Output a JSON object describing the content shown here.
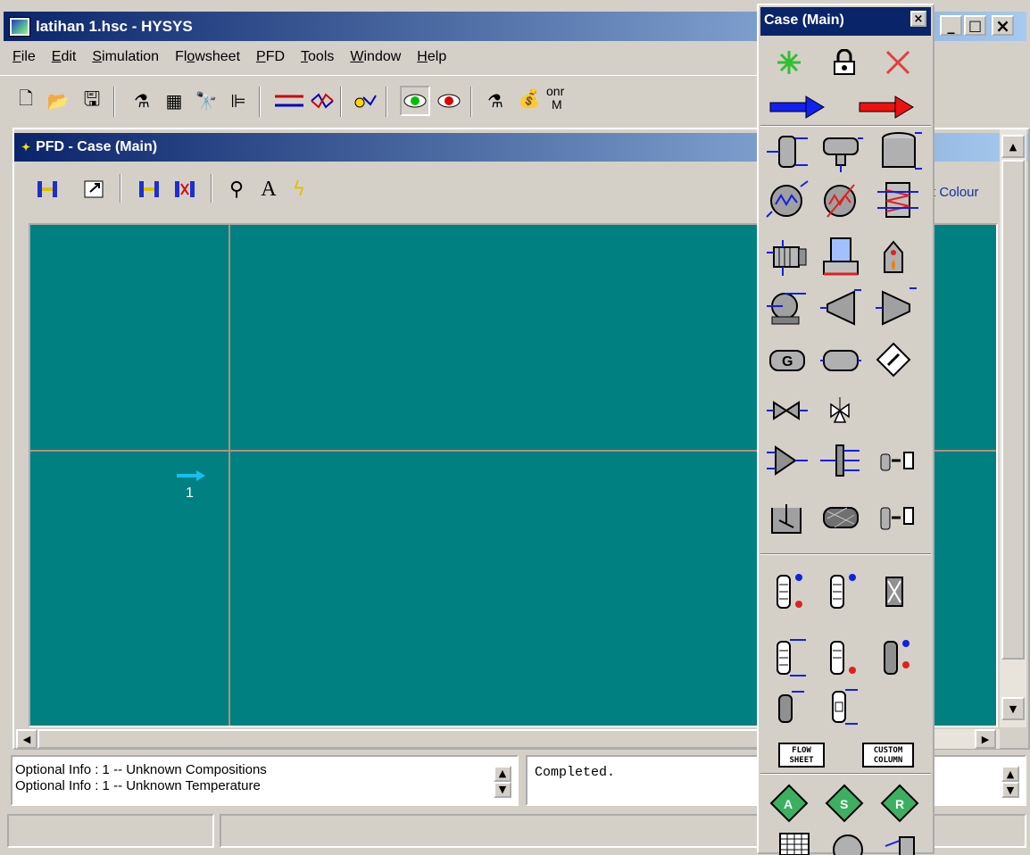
{
  "app": {
    "title": "latihan 1.hsc - HYSYS",
    "btn_min": "_",
    "btn_max": "□",
    "btn_close": "×"
  },
  "menu": [
    {
      "label": "File"
    },
    {
      "label": "Edit"
    },
    {
      "label": "Simulation"
    },
    {
      "label": "Flowsheet"
    },
    {
      "label": "PFD"
    },
    {
      "label": "Tools"
    },
    {
      "label": "Window"
    },
    {
      "label": "Help"
    }
  ],
  "toolbar": {
    "partial_text_1": "onr",
    "partial_text_2": "M"
  },
  "pfd": {
    "title": "PFD - Case (Main)",
    "tools": [
      "zoom-all",
      "size-mode",
      "attach-mode",
      "break-connection",
      "zoom-window",
      "add-text",
      "auto-position"
    ],
    "colour_label": "t Colour",
    "stream": {
      "name": "1",
      "color": "#17bfee"
    },
    "canvas_color": "#008080"
  },
  "messages": {
    "optional_1": "Optional Info  : 1 -- Unknown Compositions",
    "optional_2": "Optional Info  : 1 -- Unknown Temperature",
    "status": "Completed."
  },
  "palette": {
    "title": "Case (Main)",
    "close": "×",
    "flowsheet_label_1": "FLOW",
    "flowsheet_label_2": "SHEET",
    "custom_label_1": "CUSTOM",
    "custom_label_2": "COLUMN",
    "logic_a": "A",
    "logic_s": "S",
    "logic_r": "R",
    "g_label": "G"
  }
}
